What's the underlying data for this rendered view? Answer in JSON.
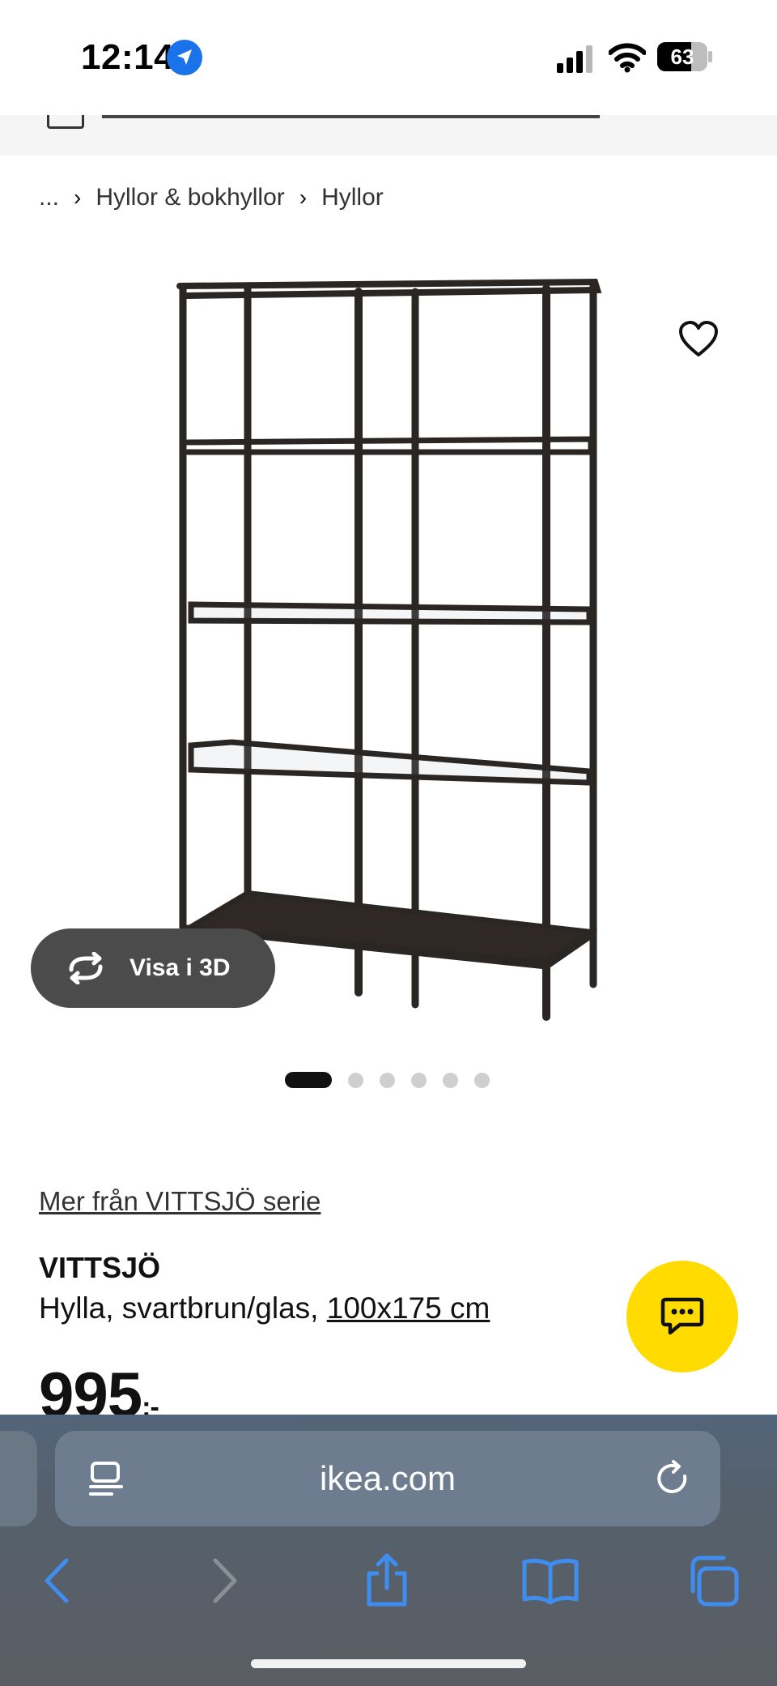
{
  "status_bar": {
    "time": "12:14",
    "battery": "63"
  },
  "breadcrumb": {
    "items": [
      "...",
      "Hyllor & bokhyllor",
      "Hyllor"
    ]
  },
  "gallery": {
    "view_3d_label": "Visa i 3D",
    "dot_count": 6,
    "active_index": 0
  },
  "product": {
    "series_link": "Mer från VITTSJÖ serie",
    "name": "VITTSJÖ",
    "description_prefix": "Hylla, svartbrun/glas, ",
    "size_link": "100x175 cm",
    "price": "995",
    "price_suffix": ":-"
  },
  "browser": {
    "url": "ikea.com"
  },
  "colors": {
    "chat_button": "#ffdb00",
    "link_blue": "#3d8ef0",
    "dark_pill": "#4b4b4b"
  },
  "icons": [
    "location-arrow-icon",
    "signal-icon",
    "wifi-icon",
    "battery-icon",
    "heart-icon",
    "rotate-3d-icon",
    "chat-icon",
    "reader-icon",
    "reload-icon",
    "back-icon",
    "forward-icon",
    "share-icon",
    "bookmarks-icon",
    "tabs-icon"
  ]
}
